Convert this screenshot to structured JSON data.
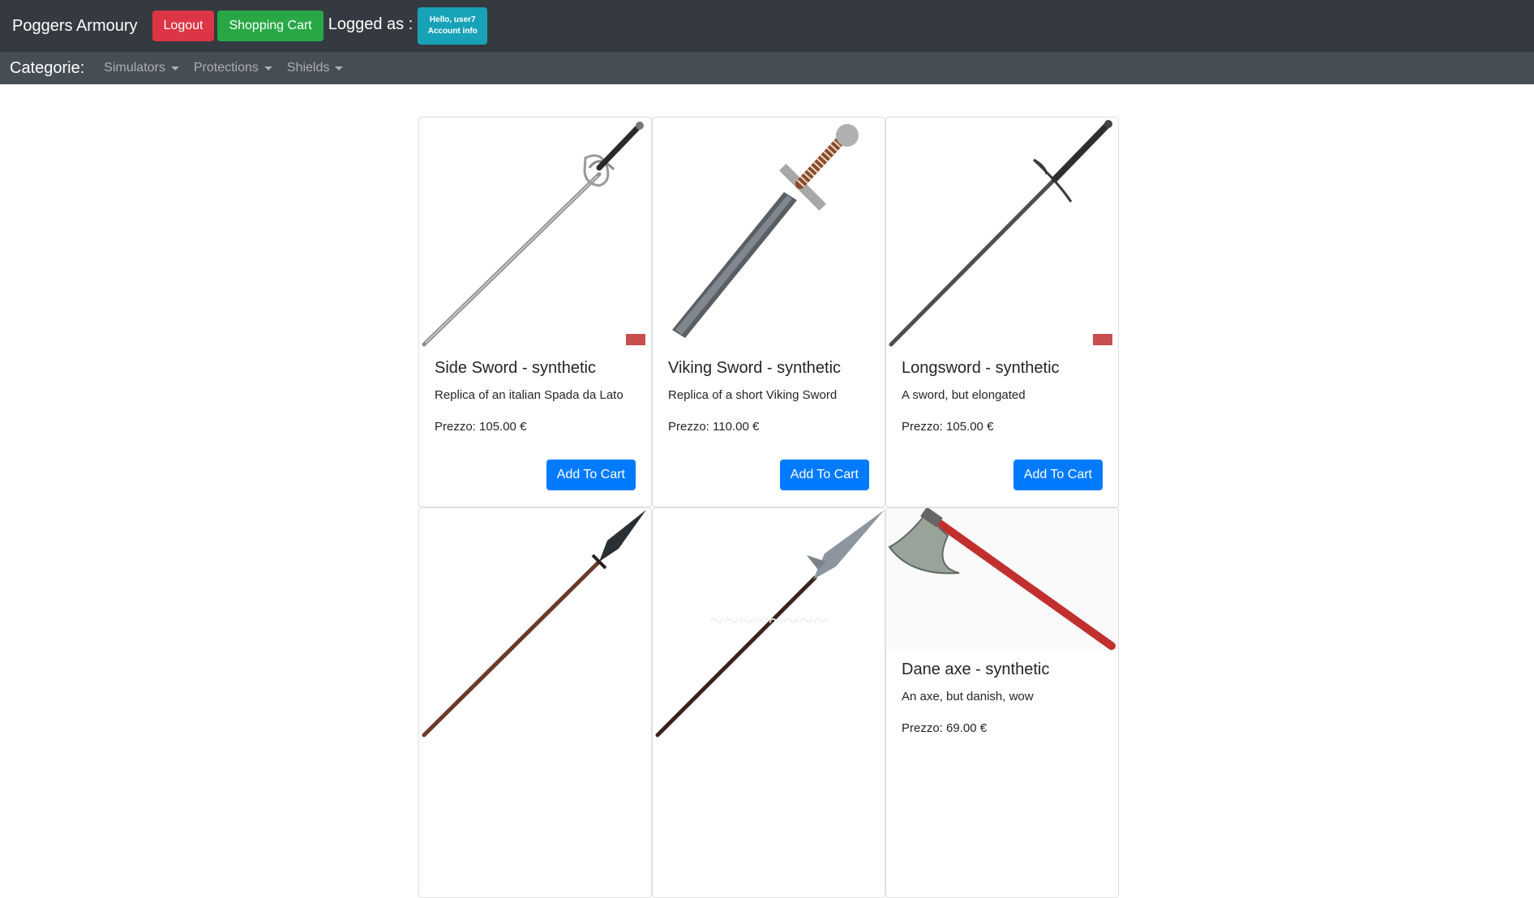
{
  "header": {
    "brand": "Poggers Armoury",
    "logout_label": "Logout",
    "cart_label": "Shopping Cart",
    "logged_as": "Logged as :",
    "account_line1": "Hello, user7",
    "account_line2": "Account info"
  },
  "categories": {
    "title": "Categorie:",
    "items": [
      "Simulators",
      "Protections",
      "Shields"
    ]
  },
  "products": [
    {
      "name": "Side Sword - synthetic",
      "desc": "Replica of an italian Spada da Lato",
      "price": "Prezzo: 105.00 €",
      "button": "Add To Cart"
    },
    {
      "name": "Viking Sword - synthetic",
      "desc": "Replica of a short Viking Sword",
      "price": "Prezzo: 110.00 €",
      "button": "Add To Cart"
    },
    {
      "name": "Longsword - synthetic",
      "desc": "A sword, but elongated",
      "price": "Prezzo: 105.00 €",
      "button": "Add To Cart"
    },
    {
      "name": "",
      "desc": "",
      "price": "",
      "button": ""
    },
    {
      "name": "",
      "desc": "",
      "price": "",
      "button": ""
    },
    {
      "name": "Dane axe - synthetic",
      "desc": "An axe, but danish, wow",
      "price": "Prezzo: 69.00 €",
      "button": ""
    }
  ],
  "colors": {
    "navbar": "#343a40",
    "subnav": "#454d55",
    "danger": "#dc3545",
    "success": "#28a745",
    "info": "#17a2b8",
    "primary": "#007bff"
  }
}
